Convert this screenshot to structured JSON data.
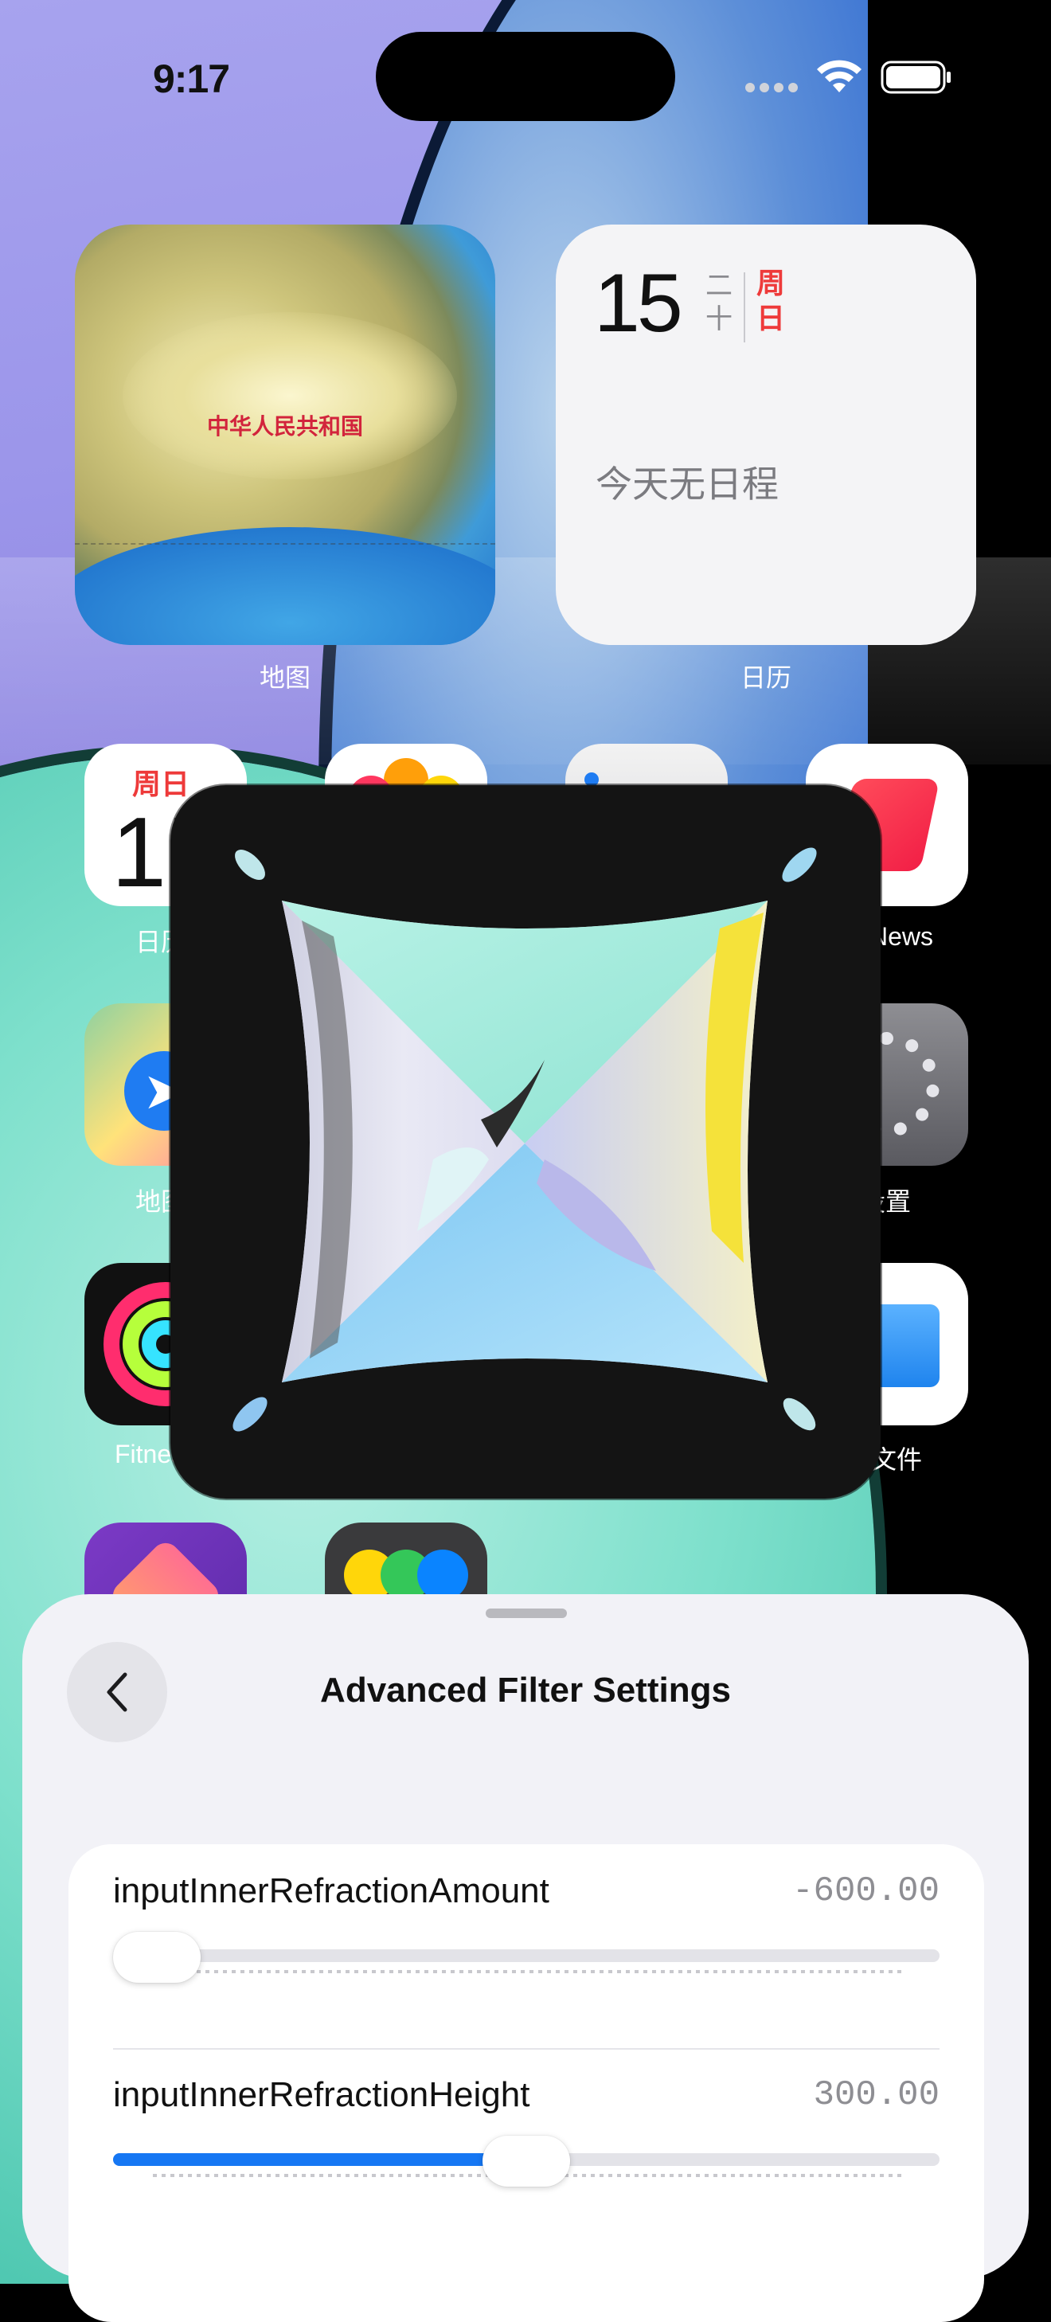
{
  "status_bar": {
    "time": "9:17"
  },
  "widgets": {
    "maps": {
      "map_label": "中华人民共和国",
      "label": "地图"
    },
    "calendar": {
      "day": "15",
      "month": "二十",
      "weekday": "周日",
      "empty_text": "今天无日程",
      "label": "日历"
    }
  },
  "apps": {
    "calendar": {
      "weekday": "周日",
      "day": "15",
      "label": "日历"
    },
    "news": {
      "label": "News"
    },
    "maps": {
      "label": "地图"
    },
    "settings": {
      "label": "设置"
    },
    "fitness": {
      "label": "Fitness"
    },
    "files": {
      "label": "文件"
    }
  },
  "sheet": {
    "title": "Advanced Filter Settings",
    "back_icon": "chevron-left-icon",
    "parameters": [
      {
        "name": "inputInnerRefractionAmount",
        "value": "-600.00",
        "slider_fraction": 0.0
      },
      {
        "name": "inputInnerRefractionHeight",
        "value": "300.00",
        "slider_fraction": 0.5
      }
    ]
  },
  "colors": {
    "accent": "#1677f3",
    "sheet_background": "#f2f2f7",
    "calendar_red": "#ee3a3a"
  }
}
